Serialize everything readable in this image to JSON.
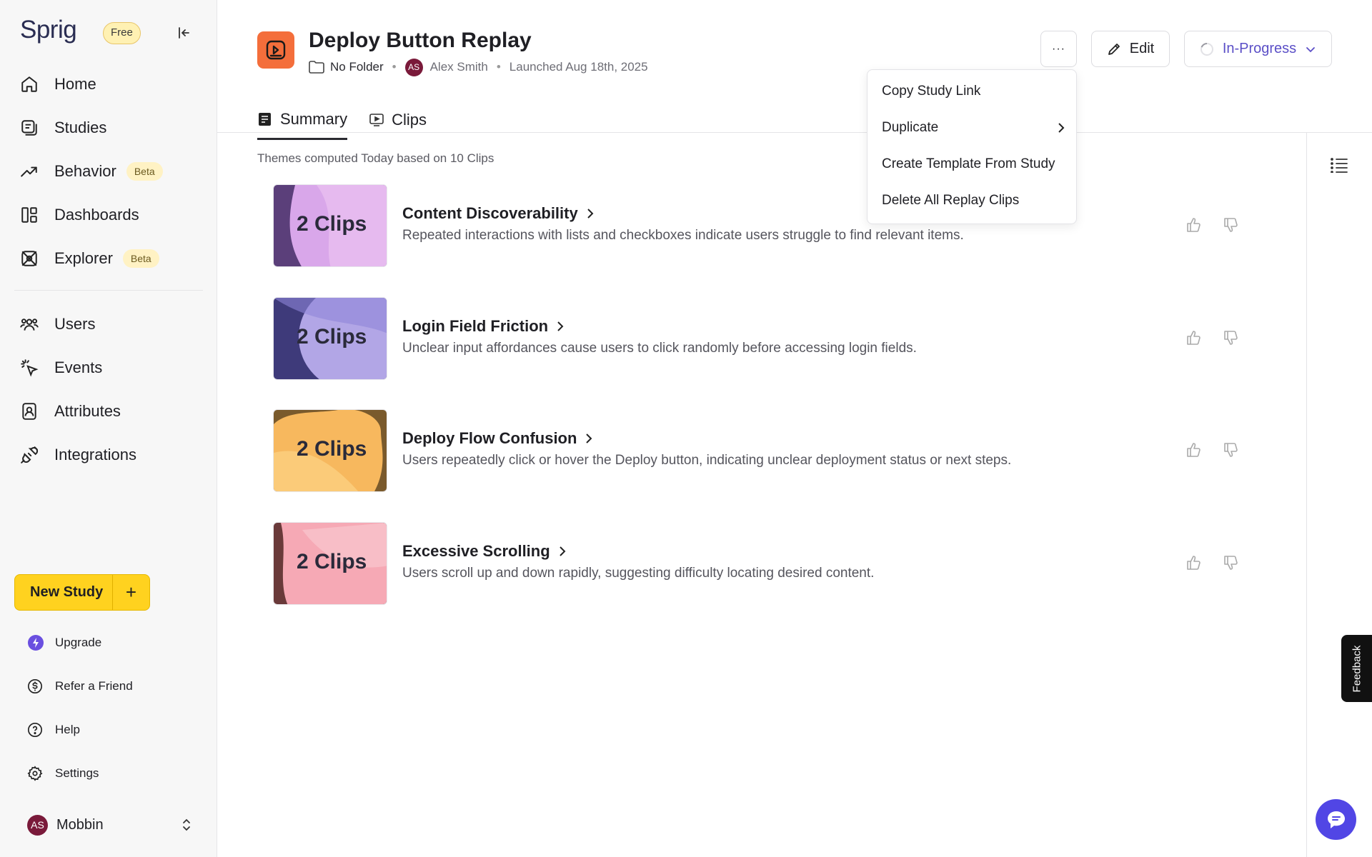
{
  "sidebar": {
    "logo": "Sprig",
    "plan_badge": "Free",
    "nav": [
      {
        "label": "Home"
      },
      {
        "label": "Studies"
      },
      {
        "label": "Behavior",
        "badge": "Beta"
      },
      {
        "label": "Dashboards"
      },
      {
        "label": "Explorer",
        "badge": "Beta"
      },
      {
        "label": "Users"
      },
      {
        "label": "Events"
      },
      {
        "label": "Attributes"
      },
      {
        "label": "Integrations"
      }
    ],
    "new_study_label": "New Study",
    "bottom": [
      {
        "label": "Upgrade"
      },
      {
        "label": "Refer a Friend"
      },
      {
        "label": "Help"
      },
      {
        "label": "Settings"
      }
    ],
    "user": {
      "initials": "AS",
      "name": "Mobbin"
    }
  },
  "header": {
    "title": "Deploy Button Replay",
    "folder": "No Folder",
    "author_initials": "AS",
    "author": "Alex Smith",
    "launched": "Launched Aug 18th, 2025",
    "more_label": "···",
    "edit_label": "Edit",
    "status_label": "In-Progress"
  },
  "tabs": [
    {
      "label": "Summary",
      "active": true
    },
    {
      "label": "Clips",
      "active": false
    }
  ],
  "themes_note": "Themes computed Today based on 10 Clips",
  "themes": [
    {
      "clips": "2 Clips",
      "title": "Content Discoverability",
      "desc": "Repeated interactions with lists and checkboxes indicate users struggle to find relevant items."
    },
    {
      "clips": "2 Clips",
      "title": "Login Field Friction",
      "desc": "Unclear input affordances cause users to click randomly before accessing login fields."
    },
    {
      "clips": "2 Clips",
      "title": "Deploy Flow Confusion",
      "desc": "Users repeatedly click or hover the Deploy button, indicating unclear deployment status or next steps."
    },
    {
      "clips": "2 Clips",
      "title": "Excessive Scrolling",
      "desc": "Users scroll up and down rapidly, suggesting difficulty locating desired content."
    }
  ],
  "menu": {
    "items": [
      {
        "label": "Copy Study Link"
      },
      {
        "label": "Duplicate",
        "submenu": true
      },
      {
        "label": "Create Template From Study"
      },
      {
        "label": "Delete All Replay Clips"
      }
    ]
  },
  "feedback_label": "Feedback",
  "colors": {
    "accent": "#ffd21f",
    "brand": "#2a2d52",
    "study_icon": "#f46e3b",
    "chat": "#5146e5",
    "status": "#5b4fc7"
  }
}
